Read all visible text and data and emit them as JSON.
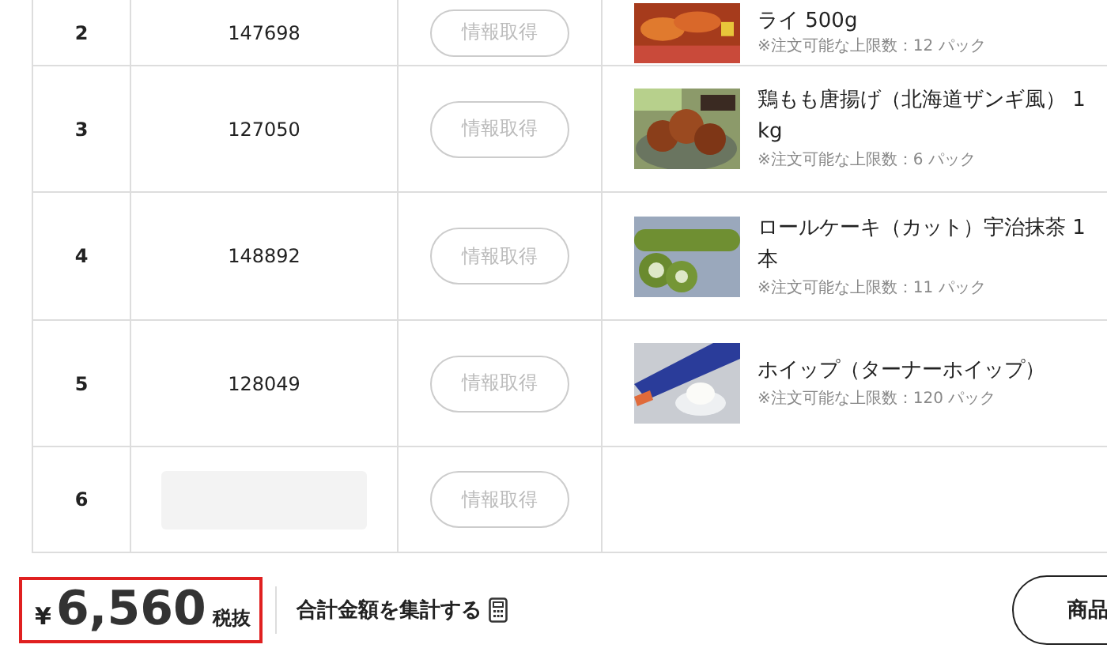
{
  "rows": [
    {
      "no": "2",
      "code": "147698",
      "button": {
        "label": "情報取得",
        "disabled": true
      },
      "product": {
        "name": "ライ 500g",
        "limit": "※注文可能な上限数：12 パック"
      }
    },
    {
      "no": "3",
      "code": "127050",
      "button": {
        "label": "情報取得",
        "disabled": true
      },
      "product": {
        "name": "鶏もも唐揚げ（北海道ザンギ風） 1 kg",
        "limit": "※注文可能な上限数：6 パック"
      }
    },
    {
      "no": "4",
      "code": "148892",
      "button": {
        "label": "情報取得",
        "disabled": true
      },
      "product": {
        "name": "ロールケーキ（カット）宇治抹茶 1 本",
        "limit": "※注文可能な上限数：11 パック"
      }
    },
    {
      "no": "5",
      "code": "128049",
      "button": {
        "label": "情報取得",
        "disabled": true
      },
      "product": {
        "name": "ホイップ（ターナーホイップ）",
        "limit": "※注文可能な上限数：120 パック"
      }
    },
    {
      "no": "6",
      "button": {
        "label": "情報取得",
        "disabled": true
      }
    }
  ],
  "footer": {
    "total": {
      "currency": "¥",
      "amount": "6,560",
      "tax_note": "税抜"
    },
    "aggregate_link": "合計金額を集計する",
    "product_button": "商品"
  }
}
